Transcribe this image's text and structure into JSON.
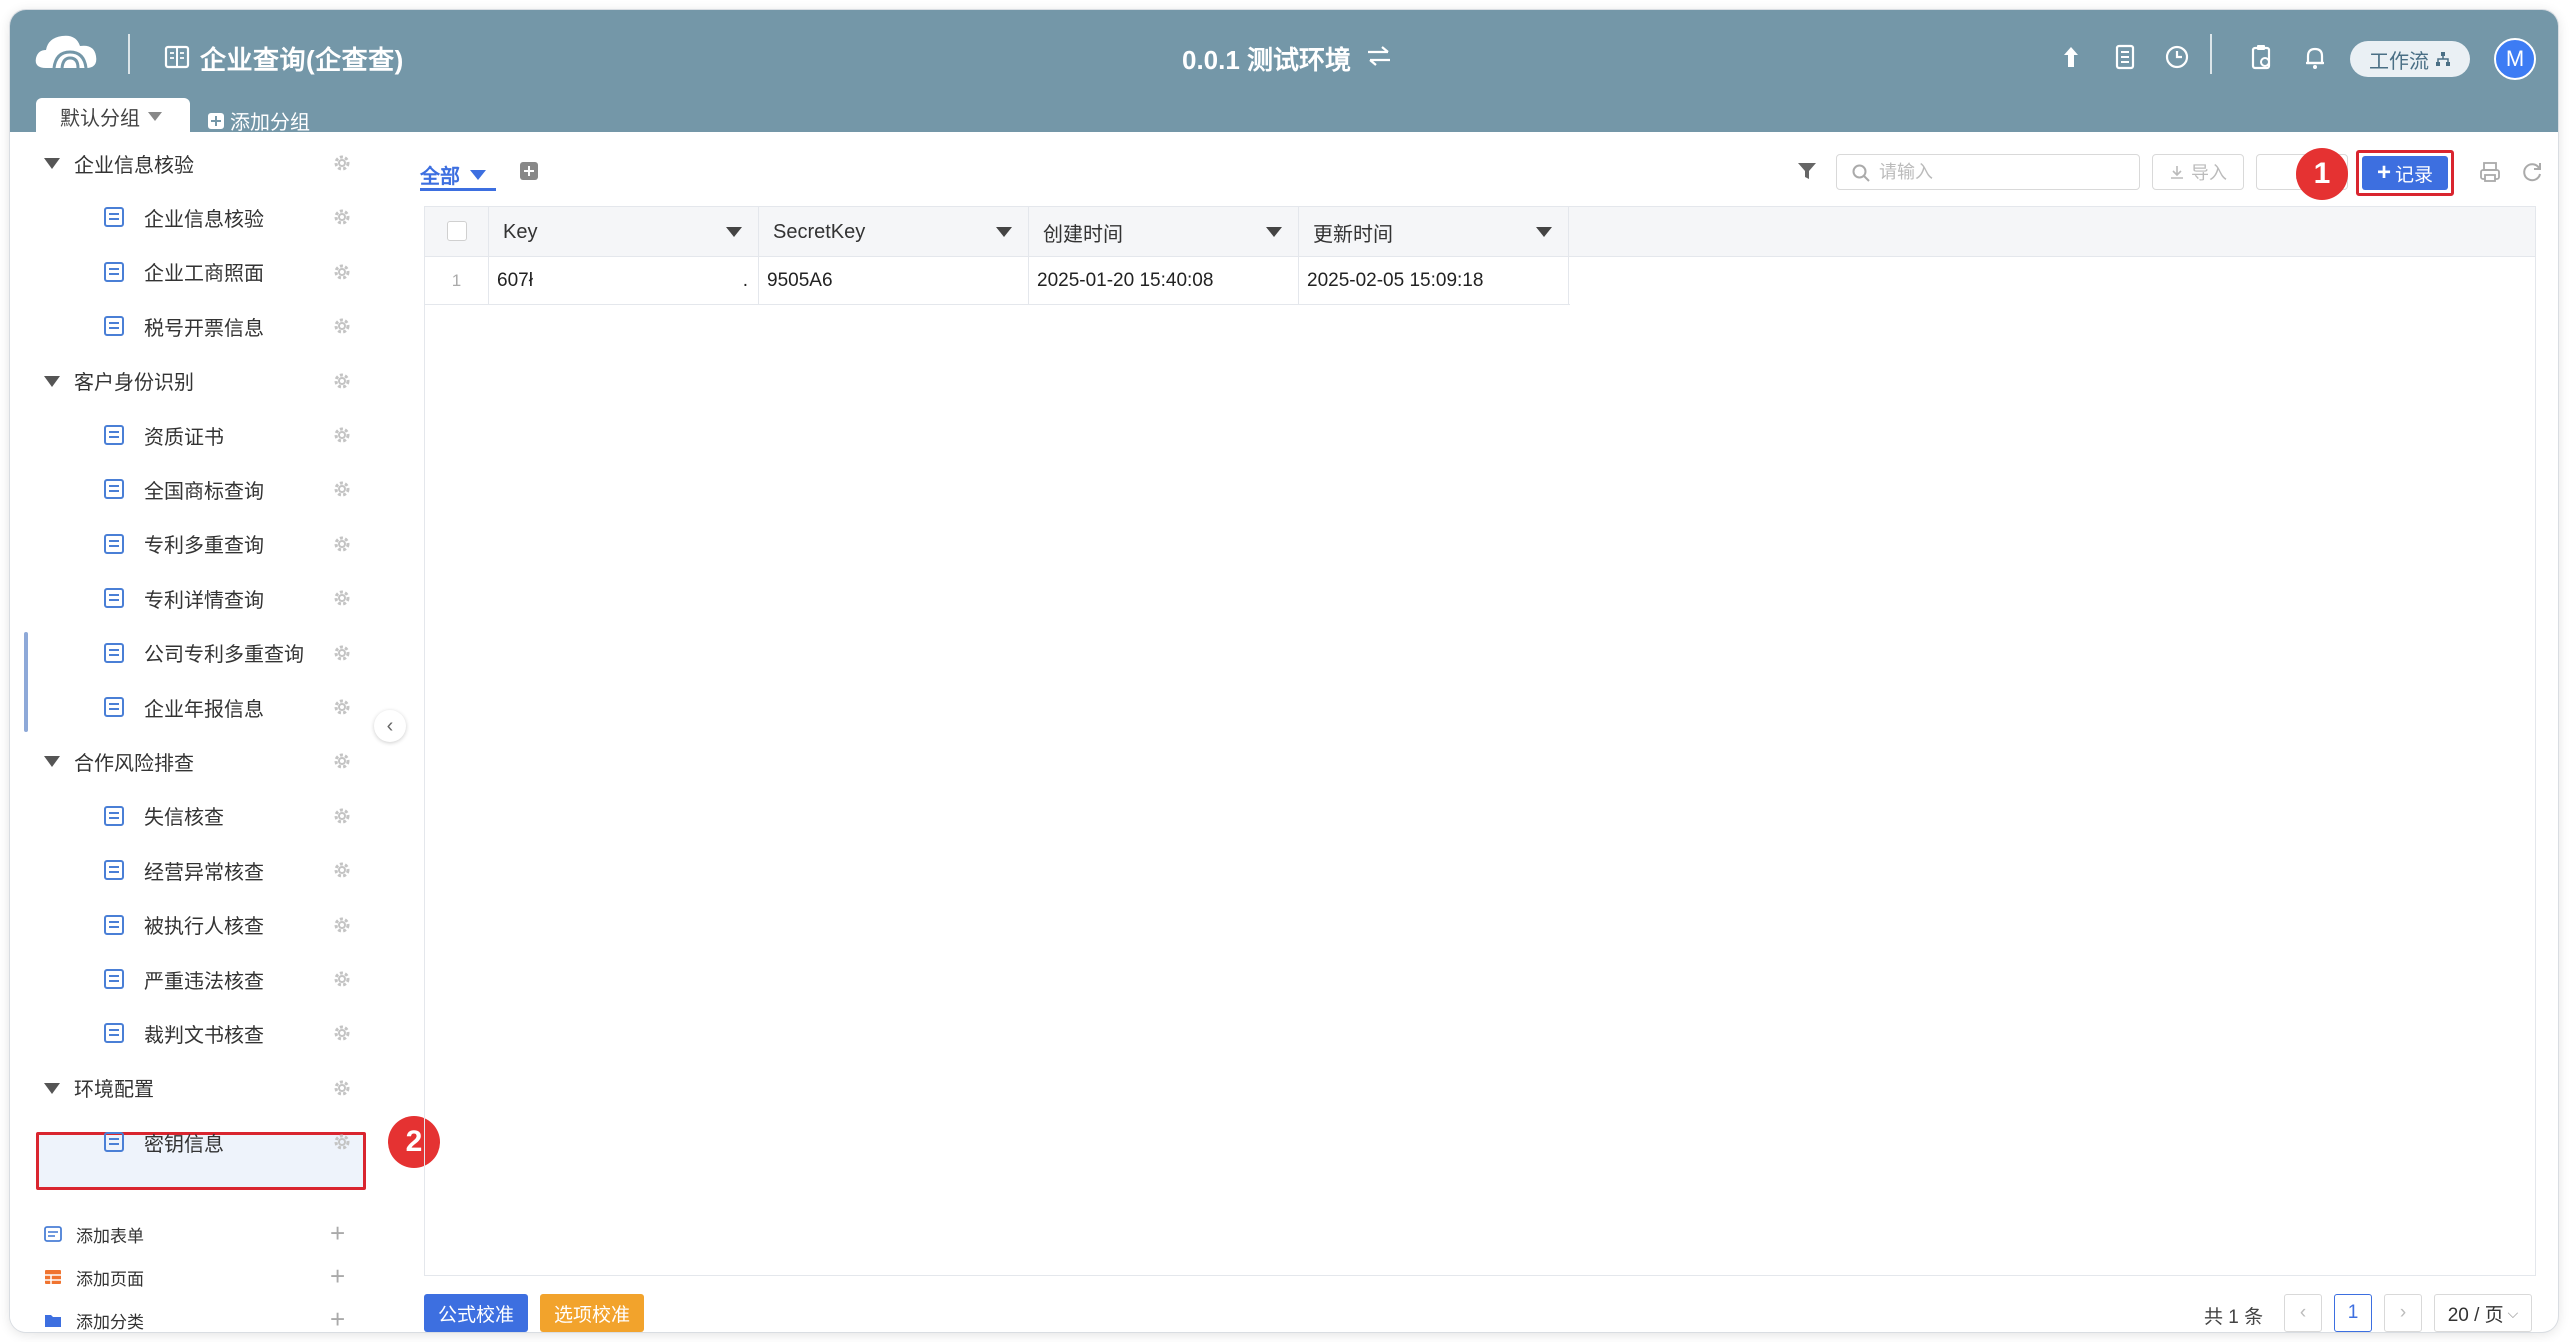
{
  "header": {
    "app_title": "企业查询(企查查)",
    "env_title": "0.0.1 测试环境",
    "workflow_label": "工作流",
    "avatar_initial": "M"
  },
  "tabs": {
    "default_group": "默认分组",
    "add_group": "添加分组"
  },
  "sidebar": {
    "groups": [
      {
        "label": "企业信息核验",
        "items": [
          "企业信息核验",
          "企业工商照面",
          "税号开票信息"
        ]
      },
      {
        "label": "客户身份识别",
        "items": [
          "资质证书",
          "全国商标查询",
          "专利多重查询",
          "专利详情查询",
          "公司专利多重查询",
          "企业年报信息"
        ]
      },
      {
        "label": "合作风险排查",
        "items": [
          "失信核查",
          "经营异常核查",
          "被执行人核查",
          "严重违法核查",
          "裁判文书核查"
        ]
      },
      {
        "label": "环境配置",
        "items": [
          "密钥信息"
        ]
      }
    ],
    "add_form": "添加表单",
    "add_page": "添加页面",
    "add_category": "添加分类",
    "selected_item": "密钥信息"
  },
  "markers": {
    "one": "1",
    "two": "2"
  },
  "toolbar": {
    "view_all": "全部",
    "search_placeholder": "请输入",
    "import_label": "导入",
    "record_label": "记录"
  },
  "table": {
    "columns": [
      "Key",
      "SecretKey",
      "创建时间",
      "更新时间"
    ],
    "rows": [
      {
        "num": "1",
        "key": "607ł",
        "key_suffix": ".",
        "secret": "9505A6",
        "created": "2025-01-20 15:40:08",
        "updated": "2025-02-05 15:09:18"
      }
    ]
  },
  "footer": {
    "formula_btn": "公式校准",
    "option_btn": "选项校准",
    "total": "共 1 条",
    "current_page": "1",
    "page_size": "20 / 页"
  },
  "colors": {
    "header_bg": "#7497a8",
    "primary": "#3d6fe0",
    "warning": "#f2a32c",
    "highlight_red": "#d9252f"
  }
}
